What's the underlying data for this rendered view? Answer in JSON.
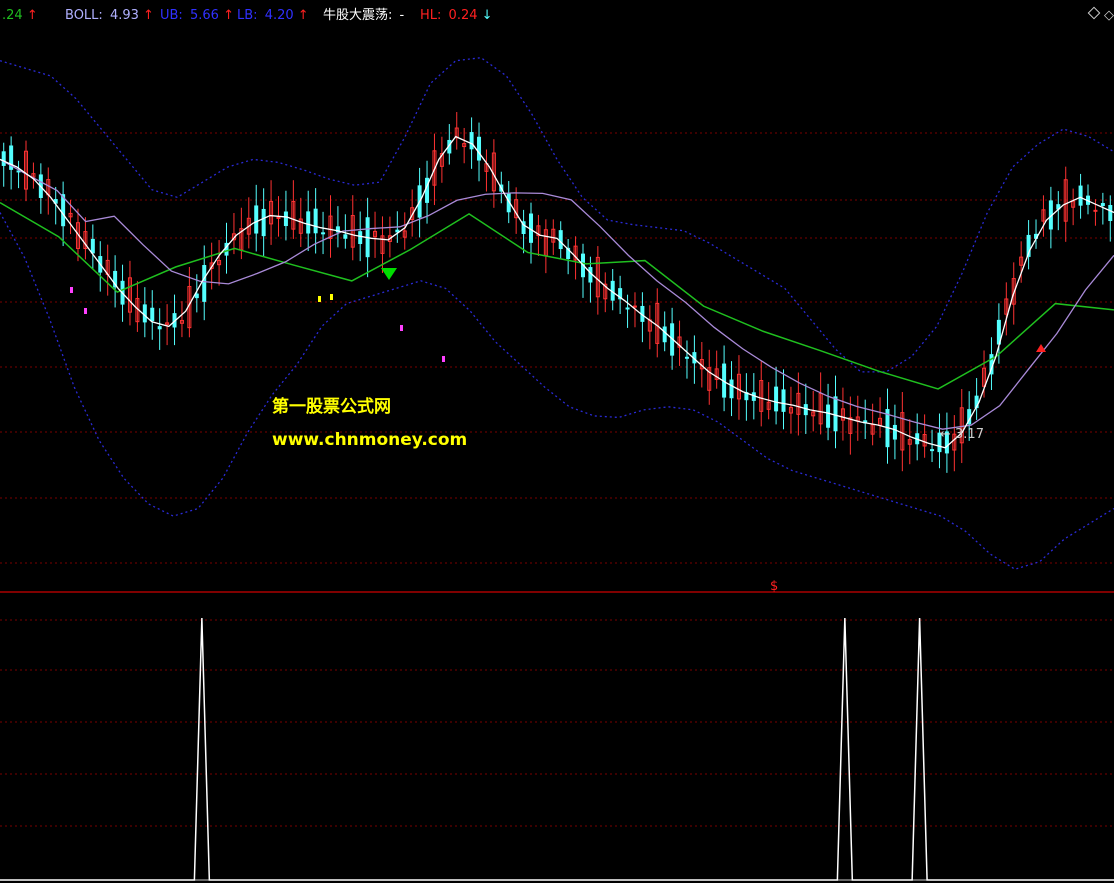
{
  "header": {
    "ma_value": ".24",
    "boll": {
      "label": "BOLL:",
      "value": "4.93"
    },
    "ub": {
      "label": "UB:",
      "value": "5.66"
    },
    "lb": {
      "label": "LB:",
      "value": "4.20"
    },
    "indicator": {
      "label": "牛股大震荡:",
      "value": "-"
    },
    "hl": {
      "label": "HL:",
      "value": "0.24"
    },
    "arrows": {
      "up": "↑",
      "down": "↓"
    }
  },
  "watermark": {
    "line1": "第一股票公式网",
    "line2": "www.chnmoney.com"
  },
  "annotations": {
    "low_price": "← 3.17",
    "signal": "$"
  },
  "colors": {
    "background": "#000000",
    "grid": "#7a0000",
    "separator": "#aa0000",
    "candle_up": "#ff3232",
    "candle_down": "#54ffff",
    "boll_mid": "#ffffff",
    "boll_band": "#2a2ad6",
    "ma_long": "#1fbf1f",
    "ma_mid": "#a98ad8",
    "header_boll": "#b0b0ff",
    "header_ub": "#3030ff",
    "header_lb": "#3030ff",
    "header_hl": "#ff2020",
    "watermark": "#ffff00",
    "arrow_up": "#ff2020",
    "arrow_down": "#54ffff",
    "marker_green": "#00dd00",
    "marker_red": "#ff2020",
    "marker_magenta": "#ff40ff",
    "marker_yellow": "#ffff00"
  },
  "chart_data": [
    {
      "type": "candlestick",
      "title": "",
      "price_range": [
        2.5,
        6.4
      ],
      "grid": true,
      "bars": 150,
      "low_annotation": 3.17,
      "series": [
        {
          "name": "BOLL",
          "values": [
            5.35,
            5.3,
            5.22,
            5.1,
            4.95,
            4.8,
            4.65,
            4.5,
            4.38,
            4.28,
            4.25,
            4.35,
            4.55,
            4.72,
            4.85,
            4.93,
            4.98,
            4.97,
            4.93,
            4.9,
            4.88,
            4.85,
            4.83,
            4.82,
            4.9,
            5.1,
            5.35,
            5.5,
            5.45,
            5.3,
            5.1,
            4.92,
            4.85,
            4.83,
            4.72,
            4.6,
            4.5,
            4.42,
            4.33,
            4.25,
            4.15,
            4.05,
            3.95,
            3.88,
            3.82,
            3.78,
            3.75,
            3.73,
            3.7,
            3.68,
            3.65,
            3.62,
            3.6,
            3.57,
            3.52,
            3.48,
            3.45,
            3.55,
            3.75,
            4.05,
            4.45,
            4.75,
            4.95,
            5.05,
            5.1,
            5.05,
            5.0
          ]
        },
        {
          "name": "UB",
          "values": [
            6.0,
            5.95,
            5.9,
            5.75,
            5.55,
            5.35,
            5.15,
            5.1,
            5.2,
            5.3,
            5.35,
            5.33,
            5.28,
            5.22,
            5.18,
            5.2,
            5.5,
            5.85,
            6.0,
            6.02,
            5.9,
            5.65,
            5.35,
            5.1,
            4.95,
            4.92,
            4.9,
            4.88,
            4.8,
            4.7,
            4.6,
            4.5,
            4.3,
            4.1,
            3.95,
            3.95,
            4.05,
            4.25,
            4.6,
            5.0,
            5.3,
            5.45,
            5.55,
            5.5,
            5.4
          ]
        },
        {
          "name": "LB",
          "values": [
            5.0,
            4.7,
            4.3,
            3.85,
            3.5,
            3.25,
            3.08,
            3.0,
            3.05,
            3.25,
            3.55,
            3.8,
            4.0,
            4.25,
            4.4,
            4.45,
            4.5,
            4.55,
            4.5,
            4.35,
            4.15,
            4.0,
            3.85,
            3.72,
            3.66,
            3.65,
            3.7,
            3.72,
            3.7,
            3.62,
            3.5,
            3.38,
            3.3,
            3.25,
            3.2,
            3.15,
            3.1,
            3.05,
            3.0,
            2.9,
            2.75,
            2.65,
            2.7,
            2.85,
            2.95,
            3.05
          ]
        }
      ],
      "markers": [
        {
          "type": "sell",
          "shape": "triangle-down",
          "color": "marker_green"
        },
        {
          "type": "buy",
          "shape": "arrow-up",
          "color": "marker_red"
        }
      ]
    },
    {
      "type": "line",
      "title": "",
      "ylim": [
        0,
        1
      ],
      "grid": true,
      "series": [
        {
          "name": "",
          "values": [
            0,
            0,
            0,
            0,
            0,
            0,
            0,
            0,
            0,
            0,
            0,
            0,
            0,
            0,
            0,
            0,
            0,
            0,
            0,
            0,
            0,
            0,
            0,
            0,
            0,
            0,
            0,
            1,
            0,
            0,
            0,
            0,
            0,
            0,
            0,
            0,
            0,
            0,
            0,
            0,
            0,
            0,
            0,
            0,
            0,
            0,
            0,
            0,
            0,
            0,
            0,
            0,
            0,
            0,
            0,
            0,
            0,
            0,
            0,
            0,
            0,
            0,
            0,
            0,
            0,
            0,
            0,
            0,
            0,
            0,
            0,
            0,
            0,
            0,
            0,
            0,
            0,
            0,
            0,
            0,
            0,
            0,
            0,
            0,
            0,
            0,
            0,
            0,
            0,
            0,
            0,
            0,
            0,
            0,
            0,
            0,
            0,
            0,
            0,
            0,
            0,
            0,
            0,
            0,
            0,
            0,
            0,
            0,
            0,
            0,
            0,
            0,
            0,
            1,
            0,
            0,
            0,
            0,
            0,
            0,
            0,
            0,
            0,
            1,
            0,
            0,
            0,
            0,
            0,
            0,
            0,
            0,
            0,
            0,
            0,
            0,
            0,
            0,
            0,
            0,
            0,
            0,
            0,
            0,
            0,
            0,
            0,
            0,
            0,
            0
          ]
        }
      ]
    }
  ]
}
